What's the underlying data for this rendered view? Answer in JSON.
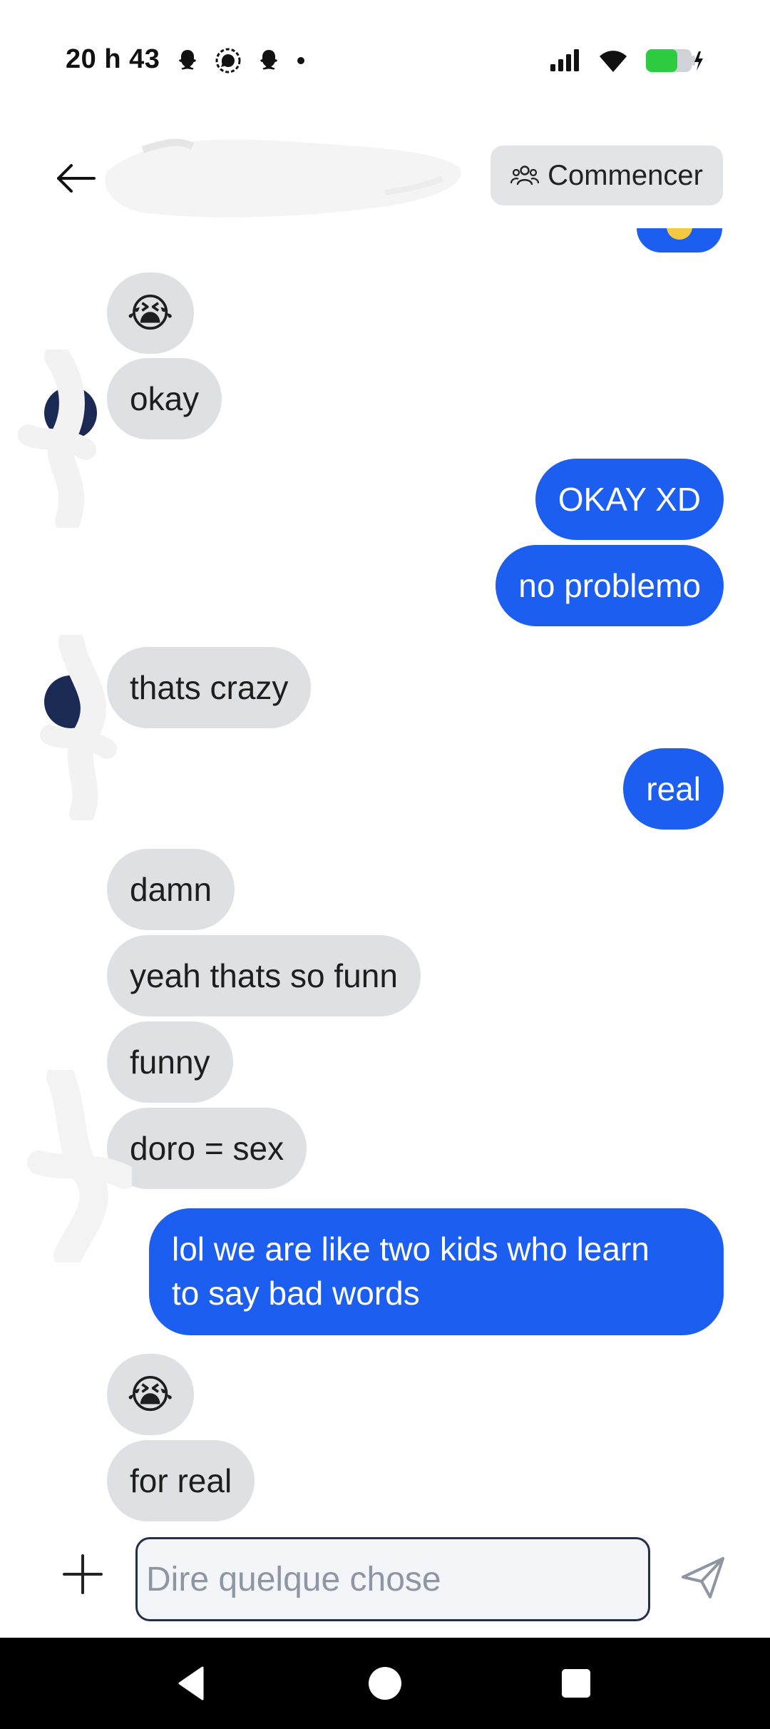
{
  "status_bar": {
    "time": "20 h 43",
    "icons_left": [
      "snapchat-icon",
      "signal-app-icon",
      "snapchat-icon",
      "dot-icon"
    ],
    "icons_right": [
      "cellular-signal-icon",
      "wifi-icon",
      "battery-charging-icon"
    ],
    "battery_color": "#2ecc40"
  },
  "header": {
    "start_button_label": "Commencer"
  },
  "messages": [
    {
      "side": "in",
      "text": "😭",
      "kind": "emoji"
    },
    {
      "side": "in",
      "text": "okay"
    },
    {
      "side": "out",
      "text": "OKAY XD"
    },
    {
      "side": "out",
      "text": "no problemo"
    },
    {
      "side": "in",
      "text": "thats crazy"
    },
    {
      "side": "out",
      "text": "real"
    },
    {
      "side": "in",
      "text": "damn"
    },
    {
      "side": "in",
      "text": "yeah thats so funn"
    },
    {
      "side": "in",
      "text": "funny"
    },
    {
      "side": "in",
      "text": "doro = sex"
    },
    {
      "side": "out",
      "text": "lol we are like two kids who learn\nto say bad words"
    },
    {
      "side": "in",
      "text": "😭",
      "kind": "emoji"
    },
    {
      "side": "in",
      "text": "for real"
    }
  ],
  "composer": {
    "placeholder": "Dire quelque chose"
  },
  "colors": {
    "outgoing_bubble": "#1c5ff0",
    "incoming_bubble": "#dfe0e4",
    "avatar": "#1b2a55"
  }
}
